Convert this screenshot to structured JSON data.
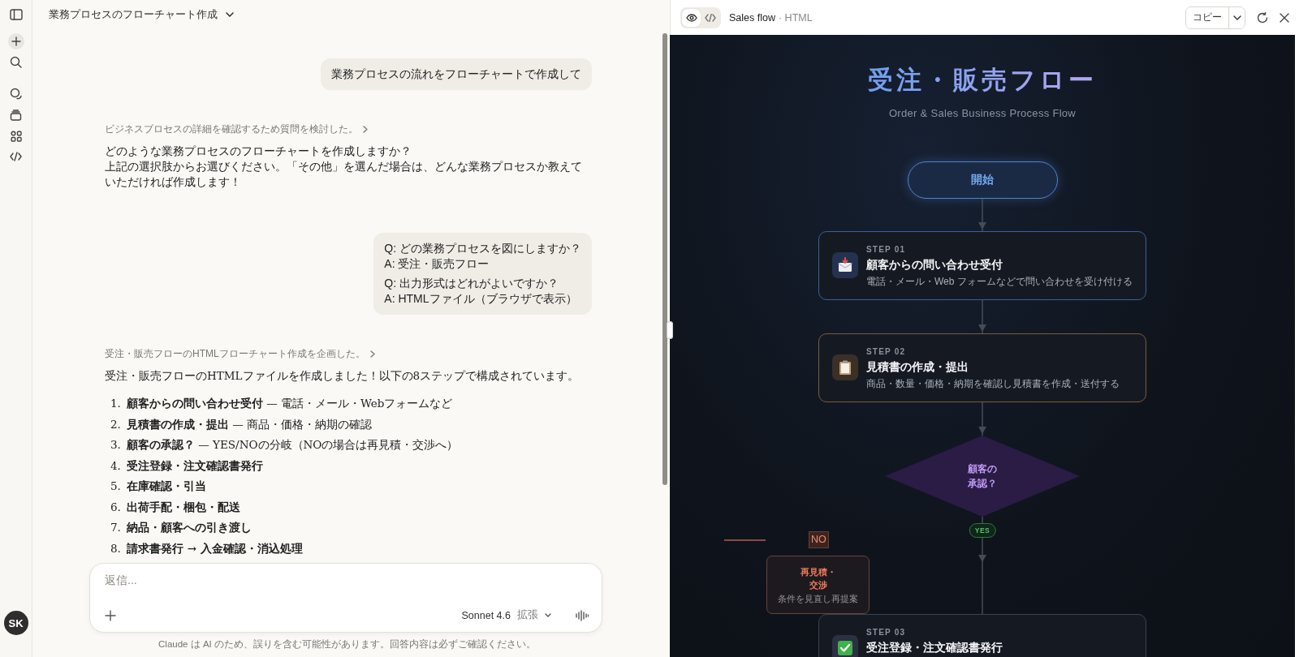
{
  "sidebar": {
    "avatar_initials": "SK"
  },
  "chat": {
    "title": "業務プロセスのフローチャート作成",
    "messages": [
      {
        "kind": "user",
        "lines": [
          "業務プロセスの流れをフローチャートで作成して"
        ]
      },
      {
        "kind": "assistant",
        "thought": "ビジネスプロセスの詳細を確認するため質問を検討した。",
        "paragraph_lines": [
          "どのような業務プロセスのフローチャートを作成しますか？",
          "上記の選択肢からお選びください。「その他」を選んだ場合は、どんな業務プロセスか教えていただければ作成します！"
        ]
      },
      {
        "kind": "user",
        "lines": [
          "Q: どの業務プロセスを図にしますか？",
          "A: 受注・販売フロー",
          "Q: 出力形式はどれがよいですか？",
          "A: HTMLファイル（ブラウザで表示）"
        ]
      },
      {
        "kind": "assistant",
        "thought": "受注・販売フローのHTMLフローチャート作成を企画した。",
        "paragraph_lines": [
          "受注・販売フローのHTMLファイルを作成しました！以下の8ステップで構成されています。"
        ],
        "list": [
          {
            "number": "1.",
            "title": "顧客からの問い合わせ受付",
            "detail": " — 電話・メール・Webフォームなど"
          },
          {
            "number": "2.",
            "title": "見積書の作成・提出",
            "detail": " — 商品・価格・納期の確認"
          },
          {
            "number": "3.",
            "title": "顧客の承認？",
            "detail": " — YES/NOの分岐（NOの場合は再見積・交渉へ）"
          },
          {
            "number": "4.",
            "title": "受注登録・注文確認書発行"
          },
          {
            "number": "5.",
            "title": "在庫確認・引当"
          },
          {
            "number": "6.",
            "title": "出荷手配・梱包・配送"
          },
          {
            "number": "7.",
            "title": "納品・顧客への引き渡し"
          },
          {
            "number": "8.",
            "title": "請求書発行 → 入金確認・消込処理"
          }
        ]
      }
    ],
    "composer": {
      "placeholder": "返信...",
      "model": "Sonnet 4.6",
      "mode": "拡張"
    },
    "disclaimer": "Claude は AI のため、誤りを含む可能性があります。回答内容は必ずご確認ください。"
  },
  "artifact": {
    "title": "Sales flow",
    "type": "· HTML",
    "view_tabs": [
      {
        "kind": "preview",
        "selected": true
      },
      {
        "kind": "code",
        "selected": false
      }
    ],
    "copy_button": "コピー",
    "flow": {
      "title": "受注・販売フロー",
      "subtitle": "Order & Sales Business Process Flow",
      "nodes": [
        {
          "kind": "start",
          "label": "開始"
        },
        {
          "kind": "step",
          "step": "STEP 01",
          "title": "顧客からの問い合わせ受付",
          "description": "電話・メール・Web フォームなどで問い合わせを受け付ける",
          "color": "#3a5f9c"
        },
        {
          "kind": "step",
          "step": "STEP 02",
          "title": "見積書の作成・提出",
          "description": "商品・数量・価格・納期を確認し見積書を作成・送付する",
          "color": "#7a5a3c"
        },
        {
          "kind": "decision",
          "label": "顧客の承認？",
          "yes_label": "YES",
          "no_label": "NO",
          "rework_title": "再見積・交渉",
          "rework_description": "条件を見直し再提案"
        },
        {
          "kind": "step",
          "step": "STEP 03",
          "title": "受注登録・注文確認書発行",
          "color": "#3a4252"
        }
      ]
    }
  }
}
